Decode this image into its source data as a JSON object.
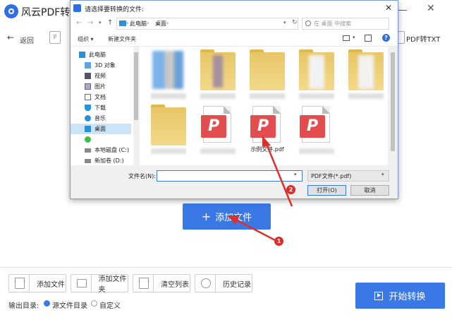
{
  "app": {
    "title": "风云PDF转换",
    "back_label": "返回",
    "pdf_tool_icon": "P",
    "pdf_to_txt_label": "PDF转TXT",
    "add_file_button": "添加文件",
    "add_file_plus": "+",
    "close_glyph": "✕",
    "back_glyph": "←"
  },
  "bottom": {
    "buttons": {
      "add_file": "添加文件",
      "add_folder": "添加文件夹",
      "clear_list": "清空列表",
      "history": "历史记录"
    },
    "output_label": "输出目录:",
    "options": {
      "source": "源文件目录",
      "custom": "自定义"
    },
    "start_button": "开始转换"
  },
  "dialog": {
    "title": "请选择要转换的文件:",
    "close_glyph": "✕",
    "nav": {
      "back": "←",
      "forward": "→",
      "dropdown": "▾",
      "up": "↑"
    },
    "breadcrumb": [
      "此电脑",
      "桌面"
    ],
    "breadcrumb_sep": "›",
    "addr_dropdown": "▾",
    "addr_refresh": "↻",
    "search_placeholder": "在 桌面 中搜索",
    "organize": "组织 ▾",
    "new_folder": "新建文件夹",
    "view_dropdown": "▾",
    "help": "?",
    "nav_items": [
      {
        "label": "此电脑",
        "icon": "computer-icon"
      },
      {
        "label": "3D 对象",
        "icon": "3d-objects-icon"
      },
      {
        "label": "视频",
        "icon": "video-icon"
      },
      {
        "label": "图片",
        "icon": "pictures-icon"
      },
      {
        "label": "文档",
        "icon": "documents-icon"
      },
      {
        "label": "下载",
        "icon": "download-icon"
      },
      {
        "label": "音乐",
        "icon": "music-icon"
      },
      {
        "label": "桌面",
        "icon": "desktop-icon"
      },
      {
        "label": "",
        "icon": "green-app-icon"
      },
      {
        "label": "本地磁盘 (C:)",
        "icon": "drive-icon"
      },
      {
        "label": "新加卷 (D:)",
        "icon": "drive-icon"
      }
    ],
    "pdf_glyph": "P",
    "example_file": "示例文件.pdf",
    "filename_label": "文件名(N):",
    "filename_value": "",
    "filename_dropdown": "▾",
    "filetype": "PDF文件(*.pdf)",
    "filetype_dropdown": "▾",
    "open_button": "打开(O)",
    "cancel_button": "取消"
  },
  "annotations": {
    "step1": "1",
    "step2": "2"
  },
  "colors": {
    "accent": "#3a78e6",
    "pdf_red": "#e34d4d",
    "annotation_red": "#d9302b"
  }
}
